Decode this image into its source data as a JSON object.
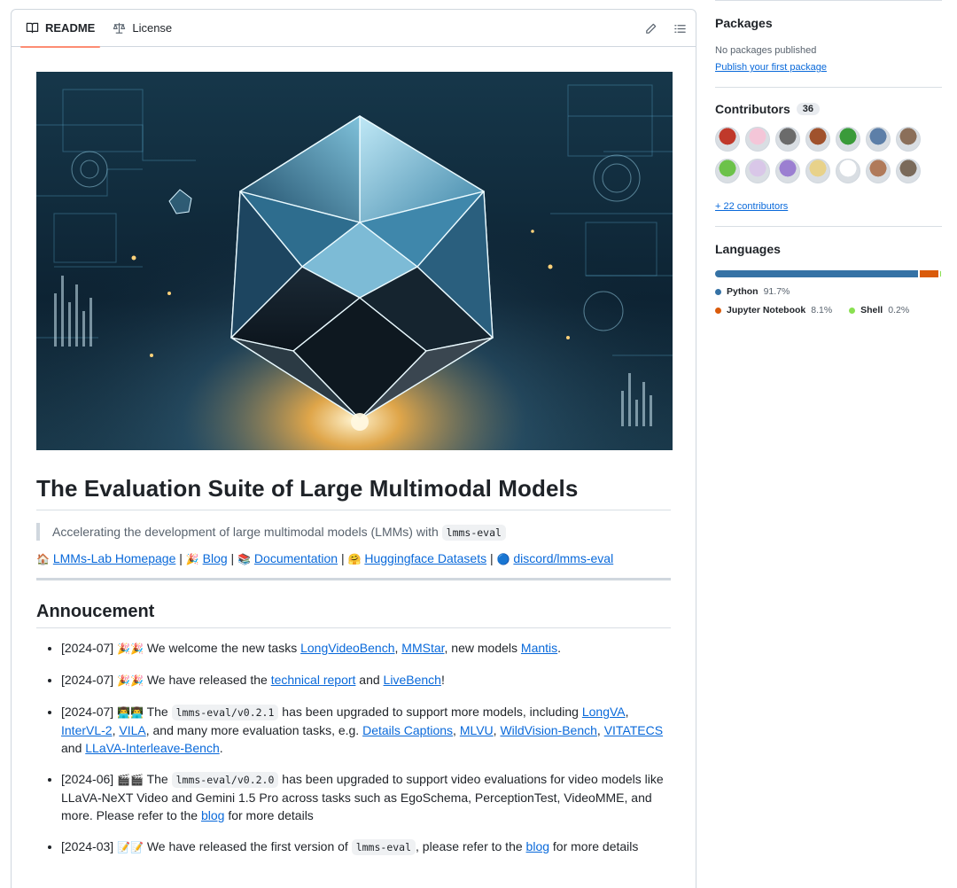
{
  "tabs": [
    {
      "label": "README",
      "icon": "book-icon",
      "active": true
    },
    {
      "label": "License",
      "icon": "scale-icon",
      "active": false
    }
  ],
  "readme": {
    "title": "The Evaluation Suite of Large Multimodal Models",
    "quote_text": "Accelerating the development of large multimodal models (LMMs) with",
    "quote_code": "lmms-eval",
    "links": [
      {
        "emoji": "🏠",
        "label": "LMMs-Lab Homepage"
      },
      {
        "emoji": "🎉",
        "label": "Blog"
      },
      {
        "emoji": "📚",
        "label": "Documentation"
      },
      {
        "emoji": "🤗",
        "label": "Huggingface Datasets"
      },
      {
        "emoji": "🔵",
        "label": "discord/lmms-eval"
      }
    ],
    "separator": "|",
    "announcement_heading": "Annoucement",
    "news": {
      "n1": {
        "date": "[2024-07]",
        "emoji": "🎉🎉",
        "t1": "We welcome the new tasks",
        "l1": "LongVideoBench",
        "l2": "MMStar",
        "t2": ", new models",
        "l3": "Mantis"
      },
      "n2": {
        "date": "[2024-07]",
        "emoji": "🎉🎉",
        "t1": "We have released the",
        "l1": "technical report",
        "t2": "and",
        "l2": "LiveBench"
      },
      "n3": {
        "date": "[2024-07]",
        "emoji": "👨‍💻👨‍💻",
        "t1": "The",
        "code": "lmms-eval/v0.2.1",
        "t2": "has been upgraded to support more models, including",
        "l1": "LongVA",
        "l2": "InterVL-2",
        "l3": "VILA",
        "t3": ", and many more evaluation tasks, e.g.",
        "l4": "Details Captions",
        "l5": "MLVU",
        "l6": "WildVision-Bench",
        "l7": "VITATECS",
        "t4": "and",
        "l8": "LLaVA-Interleave-Bench"
      },
      "n4": {
        "date": "[2024-06]",
        "emoji": "🎬🎬",
        "t1": "The",
        "code": "lmms-eval/v0.2.0",
        "t2": "has been upgraded to support video evaluations for video models like LLaVA-NeXT Video and Gemini 1.5 Pro across tasks such as EgoSchema, PerceptionTest, VideoMME, and more. Please refer to the",
        "l1": "blog",
        "t3": "for more details"
      },
      "n5": {
        "date": "[2024-03]",
        "emoji": "📝📝",
        "t1": "We have released the first version of",
        "code": "lmms-eval",
        "t2": ", please refer to the",
        "l1": "blog",
        "t3": "for more details"
      }
    }
  },
  "sidebar": {
    "packages": {
      "heading": "Packages",
      "empty_text": "No packages published",
      "link": "Publish your first package"
    },
    "contributors": {
      "heading": "Contributors",
      "count": "36",
      "more_link": "+ 22 contributors",
      "avatars": [
        "#c0392b",
        "#f4c6d8",
        "#6b6b6b",
        "#a0522d",
        "#3a9b3a",
        "#5d7fa8",
        "#8b6f5a",
        "#6cc24a",
        "#d9c7e8",
        "#9b7fd1",
        "#e8d28a",
        "#ffffff",
        "#b07a5a",
        "#7a6a5a"
      ]
    },
    "languages": {
      "heading": "Languages",
      "items": [
        {
          "name": "Python",
          "pct": "91.7%",
          "value": 91.7,
          "color": "#3572A5"
        },
        {
          "name": "Jupyter Notebook",
          "pct": "8.1%",
          "value": 8.1,
          "color": "#DA5B0B"
        },
        {
          "name": "Shell",
          "pct": "0.2%",
          "value": 0.2,
          "color": "#89e051"
        }
      ]
    }
  }
}
